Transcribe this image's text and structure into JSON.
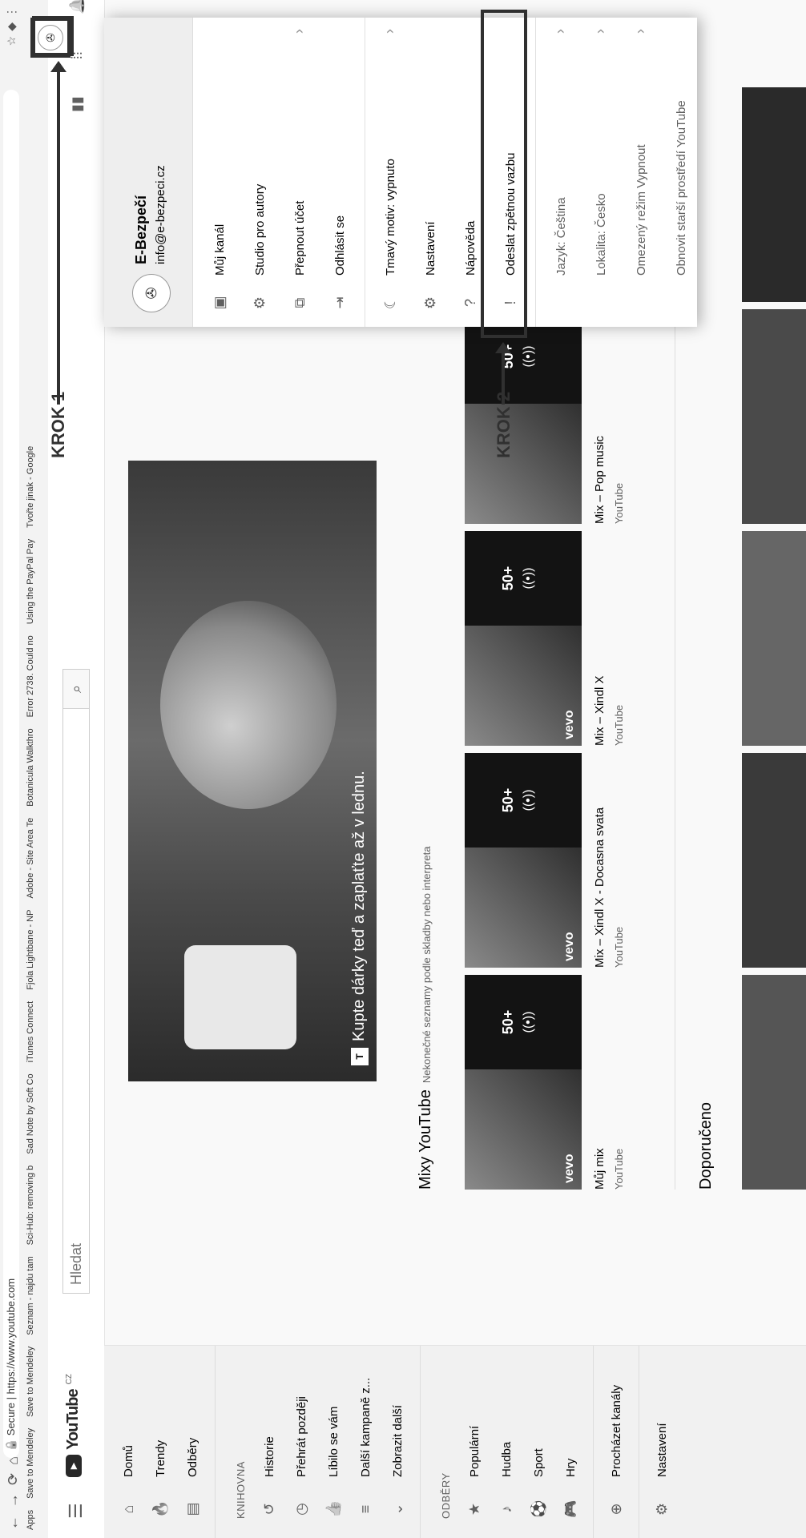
{
  "browser": {
    "secure": "Secure",
    "url": "https://www.youtube.com",
    "bookmarks": [
      "Apps",
      "Save to Mendeley",
      "Save to Mendeley",
      "Seznam - najdu tam",
      "Sci-Hub: removing b",
      "Sad Note by Soft Co",
      "iTunes Connect",
      "Fjola Lightbane - NP",
      "Adobe - Site Area Te",
      "Botanicula Walkthro",
      "Error 2738. Could no",
      "Using the PayPal Pay",
      "Tvořte jinak - Google"
    ]
  },
  "youtube": {
    "logo": "YouTube",
    "country": "CZ",
    "search_placeholder": "Hledat"
  },
  "sidebar": {
    "main": [
      {
        "label": "Domů",
        "icon": "home-icon"
      },
      {
        "label": "Trendy",
        "icon": "trending-icon"
      },
      {
        "label": "Odběry",
        "icon": "subscriptions-icon"
      }
    ],
    "library_header": "KNIHOVNA",
    "library": [
      {
        "label": "Historie",
        "icon": "history-icon"
      },
      {
        "label": "Přehrát později",
        "icon": "watch-later-icon"
      },
      {
        "label": "Líbilo se vám",
        "icon": "thumbs-up-icon"
      },
      {
        "label": "Další kampaně z...",
        "icon": "playlist-icon"
      },
      {
        "label": "Zobrazit další",
        "icon": "chevron-down-icon"
      }
    ],
    "subs_header": "ODBĚRY",
    "subs": [
      {
        "label": "Populární",
        "icon": "star-icon"
      },
      {
        "label": "Hudba",
        "icon": "music-icon"
      },
      {
        "label": "Sport",
        "icon": "sport-icon"
      },
      {
        "label": "Hry",
        "icon": "games-icon"
      }
    ],
    "browse": "Procházet kanály",
    "settings": "Nastavení"
  },
  "banner": {
    "caption": "Kupte dárky teď a zaplaťte až v lednu.",
    "badge": "T"
  },
  "mixes": {
    "title": "Mixy YouTube",
    "subtitle": "Nekonečné seznamy podle skladby nebo interpreta",
    "items": [
      {
        "title": "Můj mix",
        "channel": "YouTube",
        "count": "50+"
      },
      {
        "title": "Mix – Xindl X - Docasna svata",
        "channel": "YouTube",
        "count": "50+"
      },
      {
        "title": "Mix – Xindl X",
        "channel": "YouTube",
        "count": "50+"
      },
      {
        "title": "Mix – Pop music",
        "channel": "YouTube",
        "count": "50+"
      }
    ],
    "vevo": "vevo"
  },
  "recommended": {
    "title": "Doporučeno"
  },
  "account_menu": {
    "name": "E-Bezpečí",
    "email": "info@e-bezpeci.cz",
    "group1": [
      {
        "label": "Můj kanál",
        "icon": "channel-icon"
      },
      {
        "label": "Studio pro autory",
        "icon": "gear-icon"
      },
      {
        "label": "Přepnout účet",
        "icon": "switch-account-icon"
      },
      {
        "label": "Odhlásit se",
        "icon": "sign-out-icon"
      }
    ],
    "group2": [
      {
        "label": "Tmavý motiv: vypnuto",
        "icon": "moon-icon"
      },
      {
        "label": "Nastavení",
        "icon": "gear-icon"
      },
      {
        "label": "Nápověda",
        "icon": "help-icon"
      },
      {
        "label": "Odeslat zpětnou vazbu",
        "icon": "feedback-icon"
      }
    ],
    "language": "Jazyk: Čeština",
    "location": "Lokalita: Česko",
    "restricted": "Omezený režim Vypnout",
    "legacy": "Obnovit starší prostředí YouTube"
  },
  "annotations": {
    "krok1": "KROK 1",
    "krok2": "KROK 2",
    "accent": "#d0021b"
  }
}
